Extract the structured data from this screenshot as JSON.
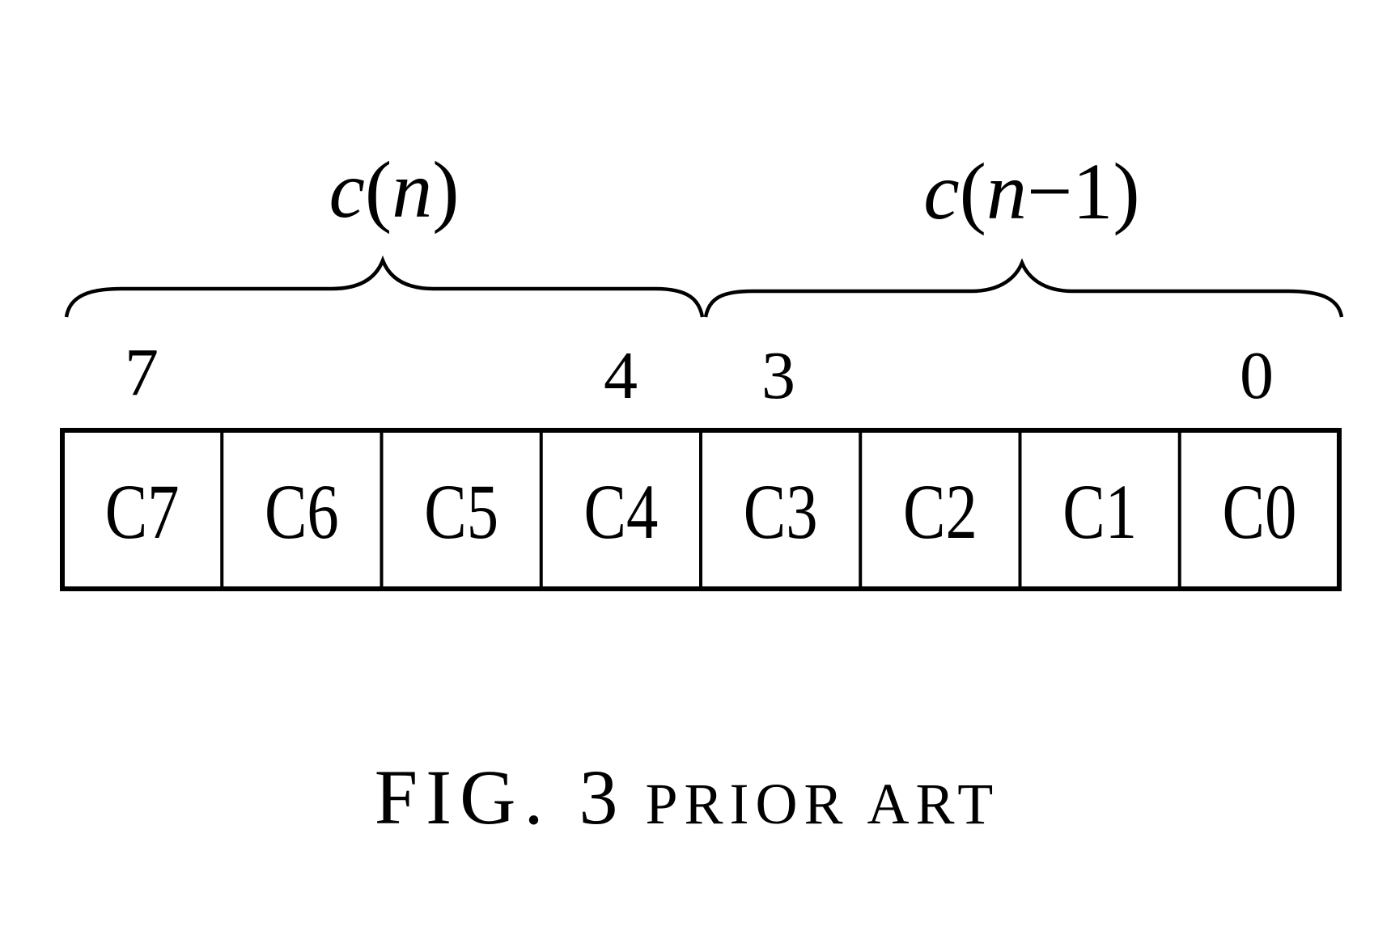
{
  "figure": {
    "caption_fig": "FIG. 3",
    "caption_suffix": "PRIOR ART"
  },
  "groups": [
    {
      "label_prefix": "c(",
      "label_var": "n",
      "label_rest": "",
      "label_close": ")",
      "high_bit": "7",
      "low_bit": "4"
    },
    {
      "label_prefix": "c(",
      "label_var": "n",
      "label_rest": "−1",
      "label_close": ")",
      "high_bit": "3",
      "low_bit": "0"
    }
  ],
  "cells": [
    "C7",
    "C6",
    "C5",
    "C4",
    "C3",
    "C2",
    "C1",
    "C0"
  ],
  "colors": {
    "ink": "#000000",
    "background": "#ffffff"
  }
}
